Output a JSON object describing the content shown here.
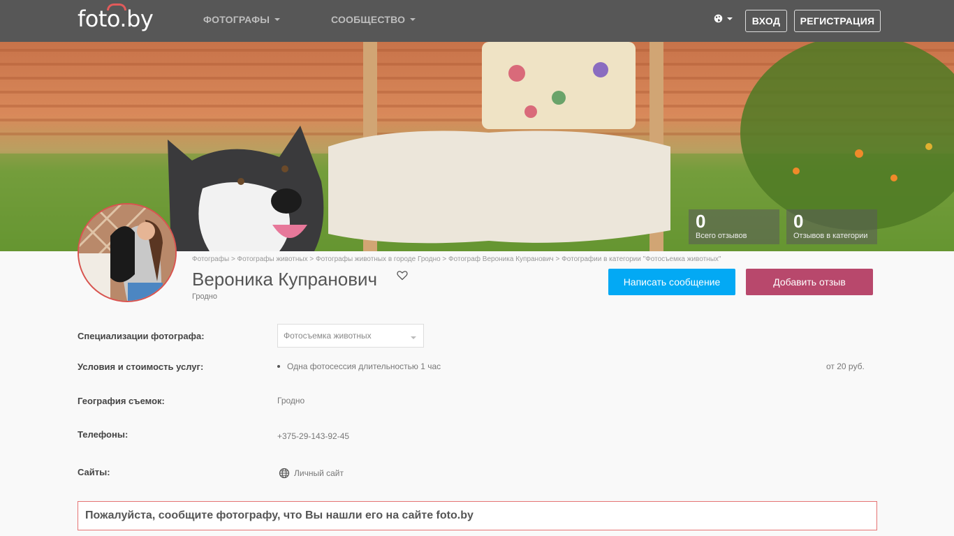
{
  "header": {
    "logo": "foto.by",
    "nav": [
      {
        "label": "ФОТОГРАФЫ"
      },
      {
        "label": "СООБЩЕСТВО"
      }
    ],
    "login_label": "ВХОД",
    "register_label": "РЕГИСТРАЦИЯ"
  },
  "stats": [
    {
      "value": "0",
      "label": "Всего отзывов"
    },
    {
      "value": "0",
      "label": "Отзывов в категории"
    }
  ],
  "breadcrumb": "Фотографы > Фотографы животных > Фотографы животных в городе Гродно > Фотограф Вероника Купранович > Фотографии в категории \"Фотосъемка животных\"",
  "profile": {
    "name": "Вероника Купранович",
    "city": "Гродно",
    "message_button": "Написать сообщение",
    "review_button": "Добавить отзыв"
  },
  "info": {
    "specializations_label": "Специализации фотографа:",
    "specialization_selected": "Фотосъемка животных",
    "services_label": "Условия и стоимость услуг:",
    "service_item": "Одна фотосессия длительностью 1 час",
    "service_price": "от 20 руб.",
    "geo_label": "География съемок:",
    "geo_value": "Гродно",
    "phones_label": "Телефоны:",
    "phone_value": "+375-29-143-92-45",
    "sites_label": "Сайты:",
    "site_value": "Личный сайт"
  },
  "notice": "Пожалуйста, сообщите фотографу, что Вы нашли его на сайте foto.by",
  "colors": {
    "header_bg": "#575757",
    "message_button": "#03a9f4",
    "review_button": "#b8486c",
    "notice_border": "#e57373"
  }
}
